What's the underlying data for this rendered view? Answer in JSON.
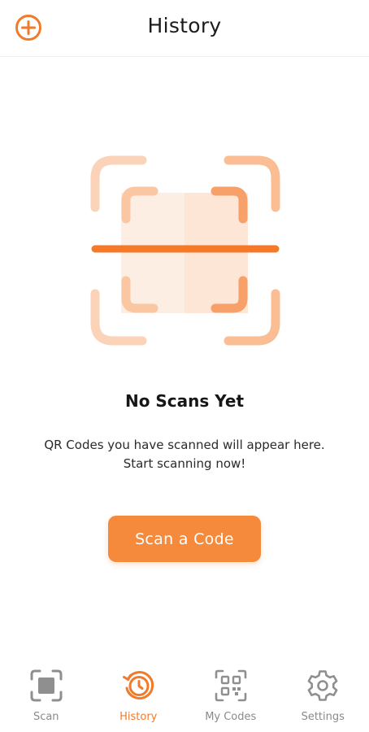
{
  "header": {
    "title": "History",
    "add_icon": "plus-circle-icon"
  },
  "empty_state": {
    "illustration_icon": "qr-scan-frame-icon",
    "title": "No Scans Yet",
    "message": "QR Codes you have scanned will appear here. Start scanning now!",
    "button_label": "Scan a  Code"
  },
  "tabbar": {
    "active": "History",
    "tabs": [
      {
        "label": "Scan",
        "icon": "scan-square-icon"
      },
      {
        "label": "History",
        "icon": "history-clock-icon"
      },
      {
        "label": "My Codes",
        "icon": "qr-code-icon"
      },
      {
        "label": "Settings",
        "icon": "gear-icon"
      }
    ]
  },
  "colors": {
    "accent": "#f58a3d",
    "accent_dark": "#f27a2b",
    "inactive": "#8a8a8a",
    "text": "#161616"
  }
}
